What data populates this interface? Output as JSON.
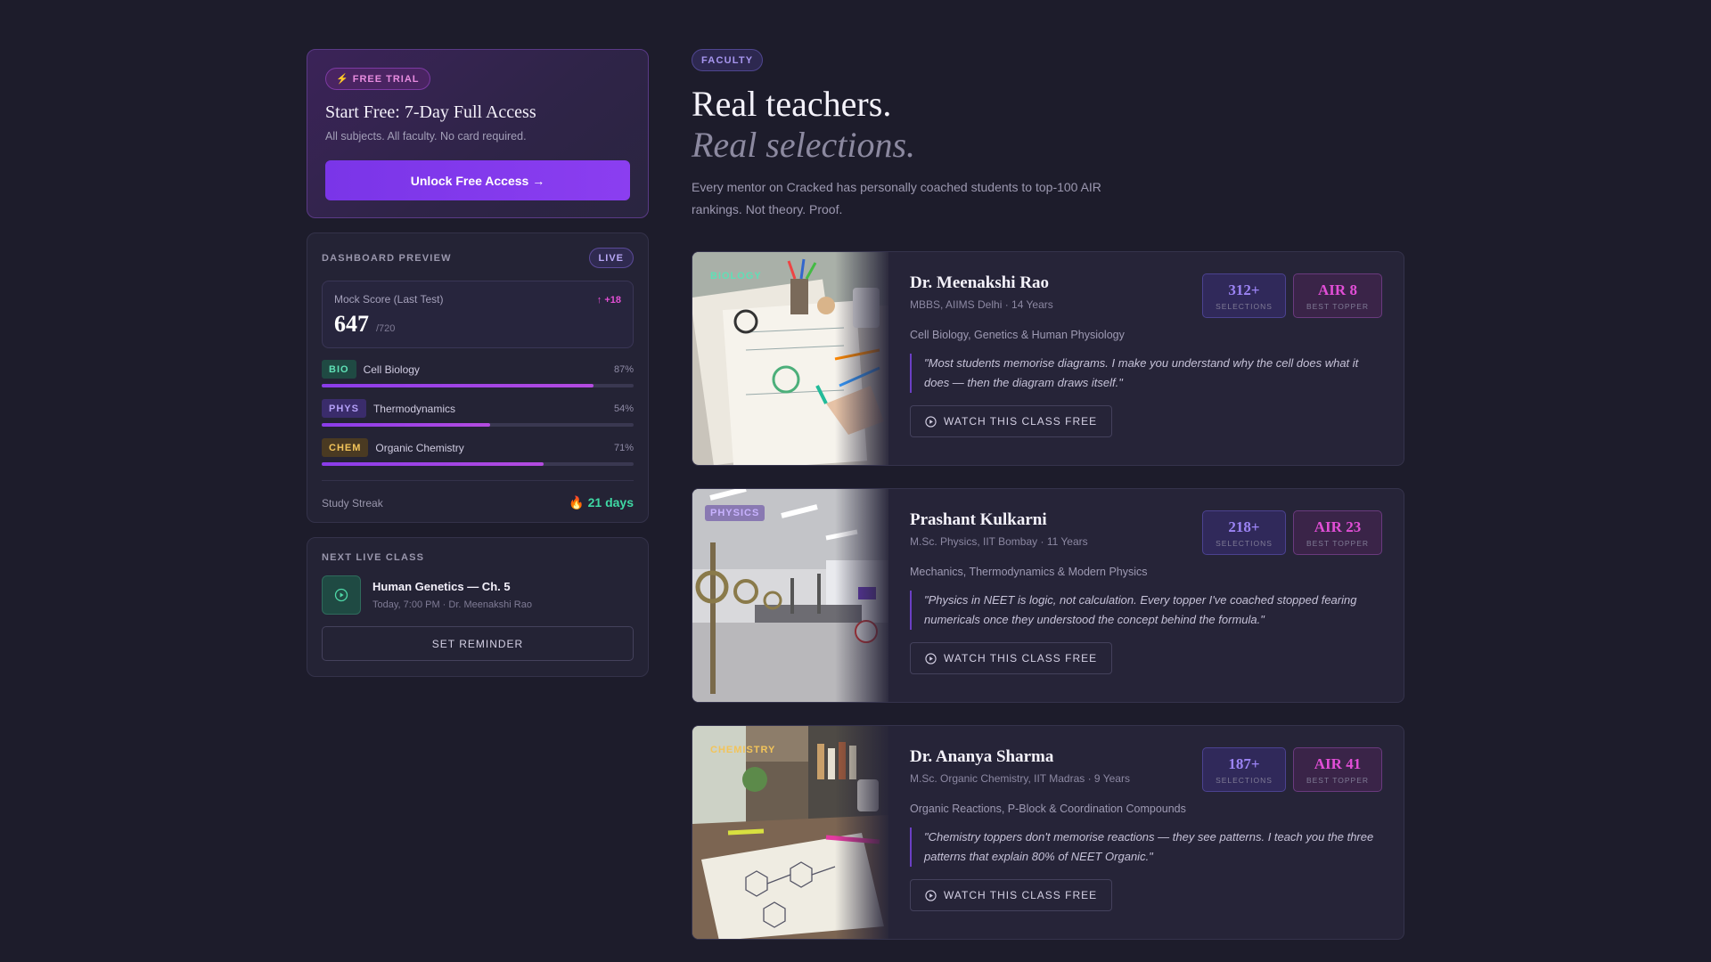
{
  "trial": {
    "badge": "⚡ FREE TRIAL",
    "title": "Start Free: 7-Day Full Access",
    "subtitle": "All subjects. All faculty. No card required.",
    "button": "Unlock Free Access →"
  },
  "dashboard": {
    "label": "DASHBOARD PREVIEW",
    "live": "LIVE",
    "mock_label": "Mock Score (Last Test)",
    "mock_delta": "↑ +18",
    "mock_score": "647",
    "mock_max": "/720",
    "subjects": [
      {
        "tag": "BIO",
        "name": "Cell Biology",
        "pct": "87%",
        "value": 0.87
      },
      {
        "tag": "PHYS",
        "name": "Thermodynamics",
        "pct": "54%",
        "value": 0.54
      },
      {
        "tag": "CHEM",
        "name": "Organic Chemistry",
        "pct": "71%",
        "value": 0.71
      }
    ],
    "streak_label": "Study Streak",
    "streak_value": "🔥 21 days"
  },
  "next_class": {
    "label": "NEXT LIVE CLASS",
    "title": "Human Genetics — Ch. 5",
    "meta": "Today, 7:00 PM · Dr. Meenakshi Rao",
    "button": "SET REMINDER"
  },
  "faculty": {
    "pill": "FACULTY",
    "headline": "Real teachers.",
    "headline_italic": "Real selections.",
    "intro": "Every mentor on Cracked has personally coached students to top-100 AIR rankings. Not theory. Proof."
  },
  "teachers": [
    {
      "tag": "BIOLOGY",
      "name": "Dr. Meenakshi Rao",
      "cred": "MBBS, AIIMS Delhi · 14 Years",
      "subjects": "Cell Biology, Genetics & Human Physiology",
      "quote": "\"Most students memorise diagrams. I make you understand why the cell does what it does — then the diagram draws itself.\"",
      "selections": "312+",
      "selections_label": "SELECTIONS",
      "air": "AIR 8",
      "air_label": "BEST TOPPER",
      "watch": "WATCH THIS CLASS FREE"
    },
    {
      "tag": "PHYSICS",
      "name": "Prashant Kulkarni",
      "cred": "M.Sc. Physics, IIT Bombay · 11 Years",
      "subjects": "Mechanics, Thermodynamics & Modern Physics",
      "quote": "\"Physics in NEET is logic, not calculation. Every topper I've coached stopped fearing numericals once they understood the concept behind the formula.\"",
      "selections": "218+",
      "selections_label": "SELECTIONS",
      "air": "AIR 23",
      "air_label": "BEST TOPPER",
      "watch": "WATCH THIS CLASS FREE"
    },
    {
      "tag": "CHEMISTRY",
      "name": "Dr. Ananya Sharma",
      "cred": "M.Sc. Organic Chemistry, IIT Madras · 9 Years",
      "subjects": "Organic Reactions, P-Block & Coordination Compounds",
      "quote": "\"Chemistry toppers don't memorise reactions — they see patterns. I teach you the three patterns that explain 80% of NEET Organic.\"",
      "selections": "187+",
      "selections_label": "SELECTIONS",
      "air": "AIR 41",
      "air_label": "BEST TOPPER",
      "watch": "WATCH THIS CLASS FREE"
    }
  ],
  "colors": {
    "background": "#1d1c2b",
    "accent_purple": "#7a35e8",
    "accent_pink": "#e14ed6",
    "accent_green": "#3fd8a4"
  }
}
